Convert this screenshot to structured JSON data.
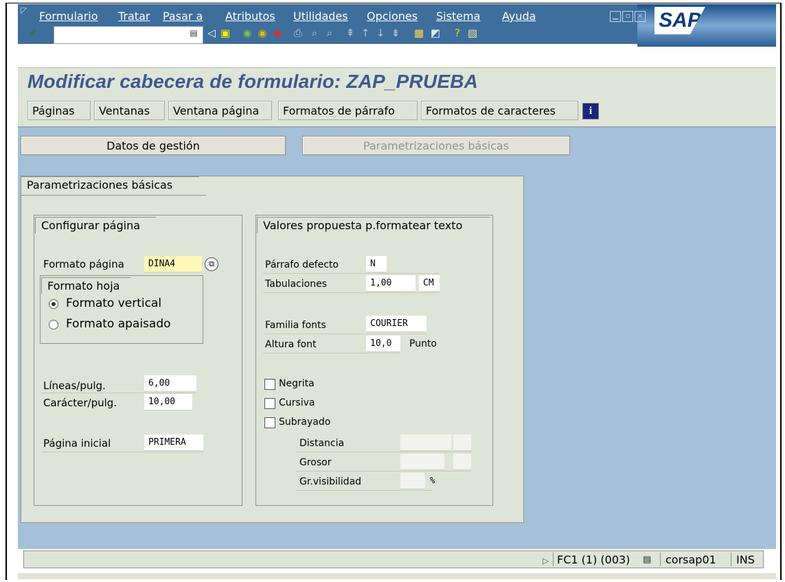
{
  "menu": {
    "items": [
      "Formulario",
      "Tratar",
      "Pasar a",
      "Atributos",
      "Utilidades",
      "Opciones",
      "Sistema",
      "Ayuda"
    ]
  },
  "toolbar": {
    "command_value": "",
    "icons": [
      "enter-icon",
      "command-history-icon",
      "back-arrow-icon",
      "save-icon",
      "back-icon",
      "exit-icon",
      "cancel-icon",
      "print-icon",
      "find-icon",
      "find-next-icon",
      "first-page-icon",
      "previous-page-icon",
      "next-page-icon",
      "last-page-icon",
      "create-session-icon",
      "shortcut-icon",
      "help-icon",
      "layout-icon"
    ]
  },
  "brand": {
    "logo": "SAP"
  },
  "page": {
    "title": "Modificar cabecera de formulario: ZAP_PRUEBA"
  },
  "app_toolbar": {
    "buttons": [
      "Páginas",
      "Ventanas",
      "Ventana página",
      "Formatos de párrafo",
      "Formatos de caracteres"
    ],
    "info_icon": "info-icon"
  },
  "view_buttons": {
    "admin": "Datos de gestión",
    "basic": "Parametrizaciones básicas"
  },
  "panel": {
    "title": "Parametrizaciones básicas",
    "page_config": {
      "title": "Configurar página",
      "page_format_label": "Formato página",
      "page_format_value": "DINA4",
      "sheet_title": "Formato hoja",
      "portrait_label": "Formato vertical",
      "landscape_label": "Formato apaisado",
      "portrait_selected": true,
      "lines_label": "Líneas/pulg.",
      "lines_value": "6,00",
      "chars_label": "Carácter/pulg.",
      "chars_value": "10,00",
      "first_page_label": "Página inicial",
      "first_page_value": "PRIMERA"
    },
    "text_defaults": {
      "title": "Valores propuesta p.formatear texto",
      "paragraph_label": "Párrafo defecto",
      "paragraph_value": "N",
      "tabs_label": "Tabulaciones",
      "tabs_value": "1,00",
      "tabs_unit": "CM",
      "font_family_label": "Familia fonts",
      "font_family_value": "COURIER",
      "font_height_label": "Altura font",
      "font_height_value": "10,0",
      "font_height_unit": "Punto",
      "bold_label": "Negrita",
      "italic_label": "Cursiva",
      "underline_label": "Subrayado",
      "distance_label": "Distancia",
      "thickness_label": "Grosor",
      "visibility_label": "Gr.visibilidad",
      "visibility_unit": "%"
    }
  },
  "status": {
    "session": "FC1 (1) (003)",
    "server": "corsap01",
    "mode": "INS"
  },
  "colors": {
    "menu_bg": "#3e6e9c",
    "content_bg": "#a5c0d8",
    "panel_bg": "#dfe4d8",
    "title_color": "#3d5a8e",
    "required_field": "#fff7b8"
  }
}
